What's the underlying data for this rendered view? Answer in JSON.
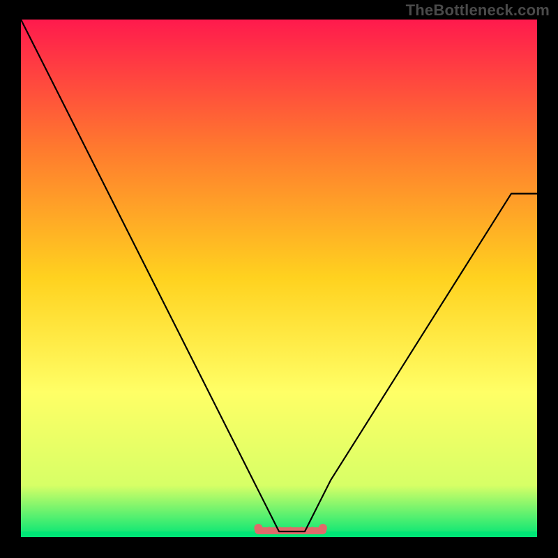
{
  "watermark": "TheBottleneck.com",
  "chart_data": {
    "type": "line",
    "title": "",
    "xlabel": "",
    "ylabel": "",
    "xlim": [
      0,
      1
    ],
    "ylim": [
      0,
      1
    ],
    "background_gradient": {
      "top": "#ff1a4d",
      "upper_mid": "#ff7a2e",
      "mid": "#ffd21f",
      "lower_mid": "#ffff66",
      "lower": "#d7ff66",
      "bottom": "#00e676"
    },
    "series": [
      {
        "name": "bottleneck-curve",
        "color": "#000000",
        "x": [
          0.0,
          0.05,
          0.1,
          0.15,
          0.2,
          0.25,
          0.3,
          0.35,
          0.4,
          0.45,
          0.475,
          0.5,
          0.525,
          0.55,
          0.575,
          0.6,
          0.65,
          0.7,
          0.75,
          0.8,
          0.85,
          0.9,
          0.95,
          1.0
        ],
        "values": [
          1.0,
          0.9,
          0.8,
          0.7,
          0.6,
          0.5,
          0.4,
          0.3,
          0.2,
          0.1,
          0.05,
          0.0,
          0.0,
          0.0,
          0.05,
          0.1,
          0.18,
          0.26,
          0.34,
          0.42,
          0.5,
          0.58,
          0.66,
          0.66
        ],
        "flat_region": {
          "x_start": 0.47,
          "x_end": 0.575
        }
      }
    ],
    "annotations": [
      {
        "name": "highlight-band",
        "color": "#e06a6a",
        "x_start": 0.46,
        "x_end": 0.585,
        "y": 0.0
      }
    ]
  }
}
